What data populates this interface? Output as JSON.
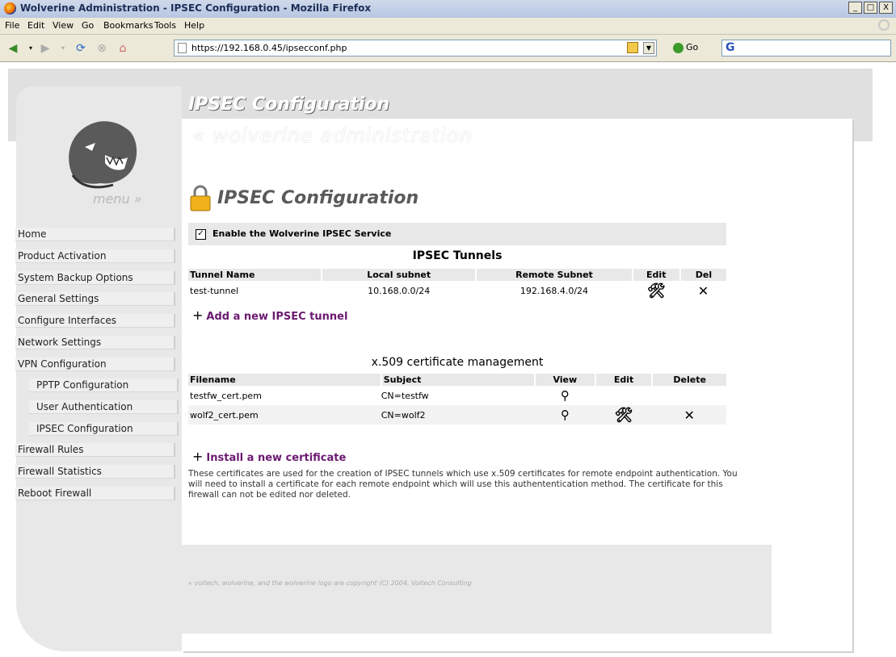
{
  "window": {
    "title": "Wolverine Administration - IPSEC Configuration - Mozilla Firefox",
    "minimize": "_",
    "maximize": "□",
    "close": "X"
  },
  "menubar": [
    "File",
    "Edit",
    "View",
    "Go",
    "Bookmarks",
    "Tools",
    "Help"
  ],
  "navbar": {
    "url": "https://192.168.0.45/ipsecconf.php",
    "go_label": "Go",
    "search_logo": "G"
  },
  "app": {
    "title": "IPSEC Configuration",
    "subtitle": "« wolverine administration",
    "menu_label": "menu »"
  },
  "sidebar": {
    "items": [
      {
        "label": "Home"
      },
      {
        "label": "Product Activation"
      },
      {
        "label": "System Backup Options"
      },
      {
        "label": "General Settings"
      },
      {
        "label": "Configure Interfaces"
      },
      {
        "label": "Network Settings"
      },
      {
        "label": "VPN Configuration"
      },
      {
        "label": "PPTP Configuration"
      },
      {
        "label": "User Authentication"
      },
      {
        "label": "IPSEC Configuration"
      },
      {
        "label": "Firewall Rules"
      },
      {
        "label": "Firewall Statistics"
      },
      {
        "label": "Reboot Firewall"
      }
    ]
  },
  "page": {
    "heading": "IPSEC Configuration",
    "enable_label": "Enable the Wolverine IPSEC Service",
    "enable_checked": true
  },
  "tunnels": {
    "title": "IPSEC Tunnels",
    "headers": [
      "Tunnel Name",
      "Local subnet",
      "Remote Subnet",
      "Edit",
      "Del"
    ],
    "rows": [
      {
        "name": "test-tunnel",
        "local": "10.168.0.0/24",
        "remote": "192.168.4.0/24"
      }
    ],
    "add_label": "Add a new IPSEC tunnel"
  },
  "certs": {
    "title": "x.509 certificate management",
    "headers": [
      "Filename",
      "Subject",
      "View",
      "Edit",
      "Delete"
    ],
    "rows": [
      {
        "file": "testfw_cert.pem",
        "subject": "CN=testfw"
      },
      {
        "file": "wolf2_cert.pem",
        "subject": "CN=wolf2"
      }
    ],
    "add_label": "Install a new certificate",
    "note": "These certificates are used for the creation of IPSEC tunnels which use x.509 certificates for remote endpoint authentication. You will need to install a certificate for each remote endpoint which will use this authententication method. The certificate for this firewall can not be edited nor deleted."
  },
  "footer": {
    "copyright": "« voitech, wolverine, and the wolverine logo are copyright (C) 2004, Voitech Consulting"
  },
  "icons": {
    "tool": "🛠",
    "delete": "✕",
    "view": "magnifier-icon"
  }
}
